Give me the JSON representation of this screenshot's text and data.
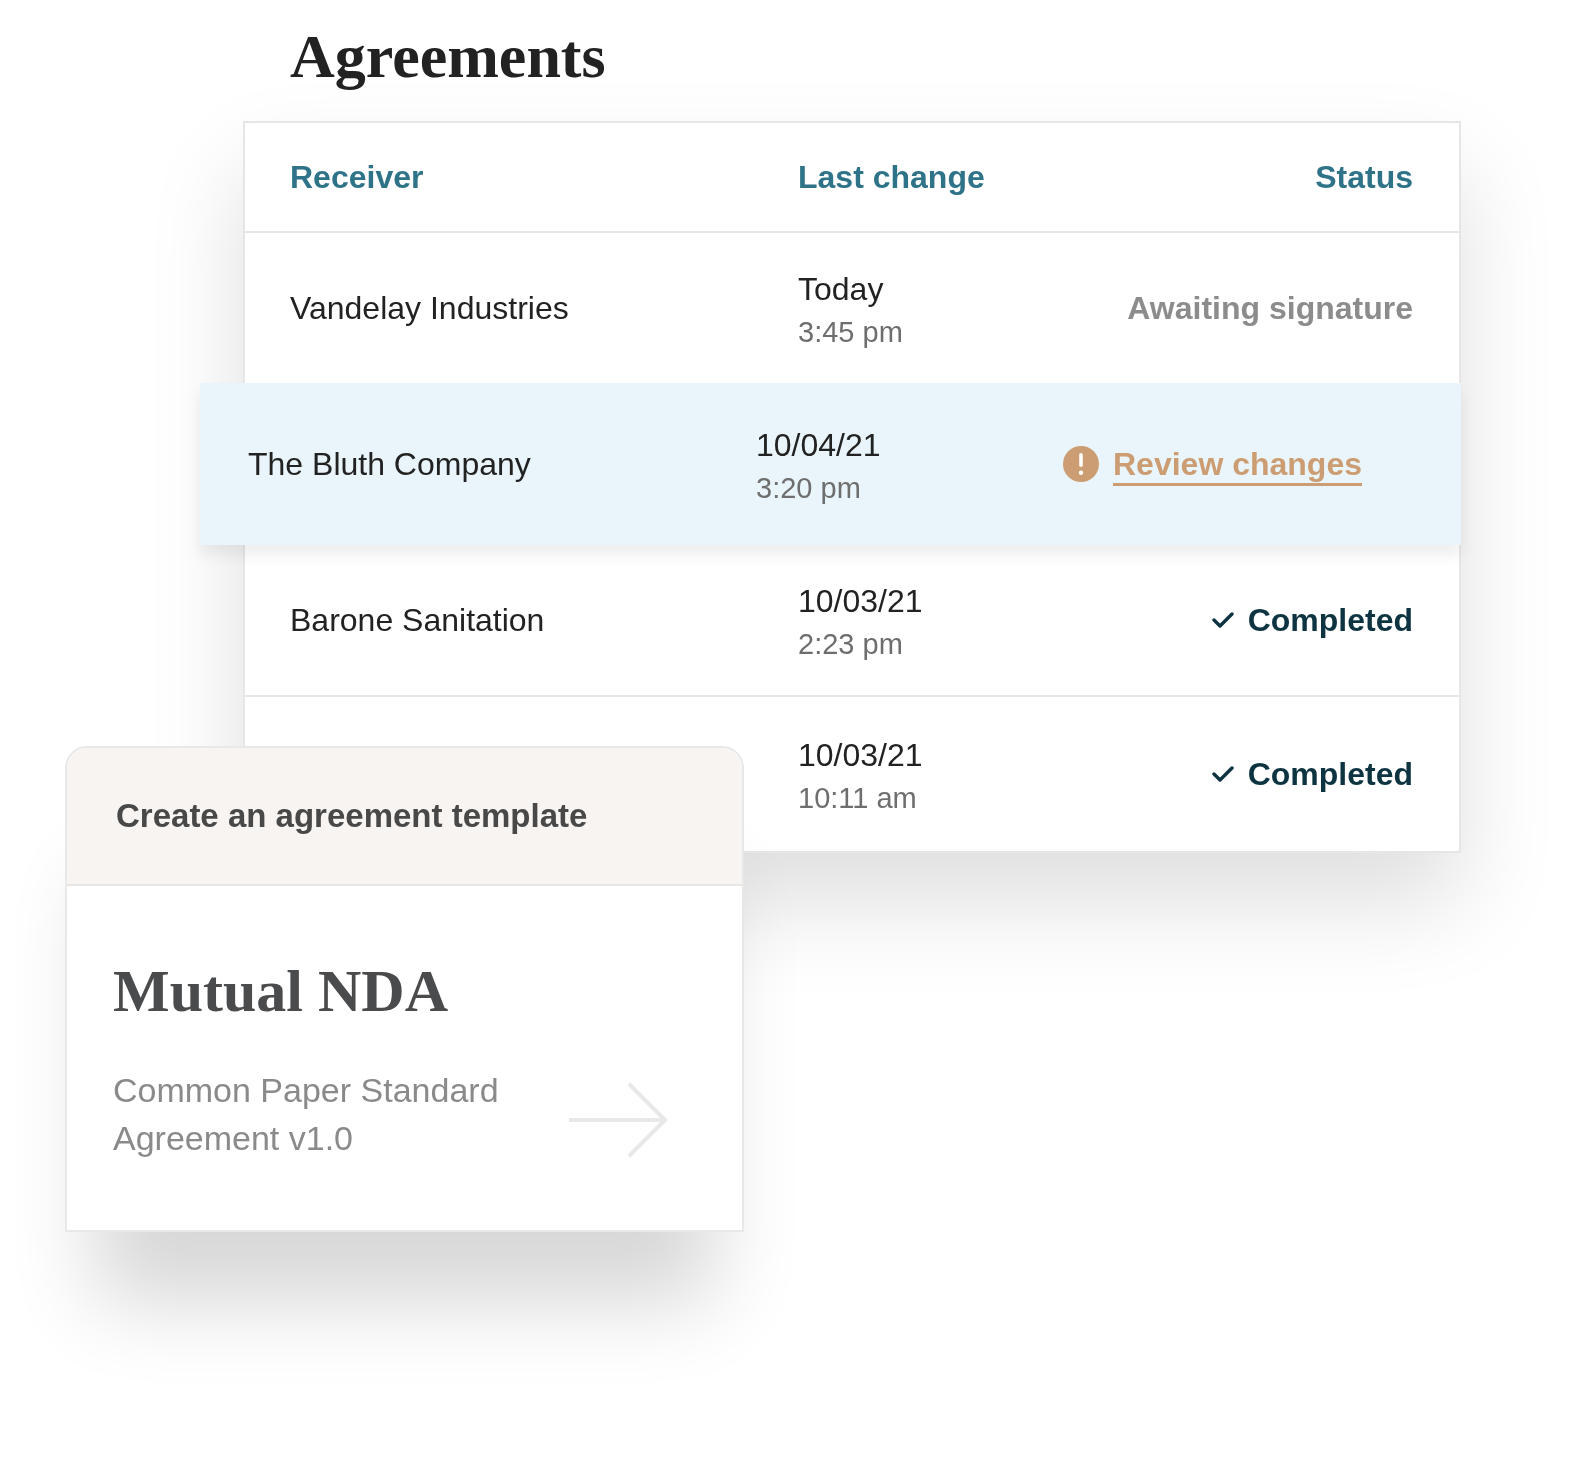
{
  "title": "Agreements",
  "table": {
    "columns": [
      "Receiver",
      "Last change",
      "Status"
    ],
    "rows": [
      {
        "receiver": "Vandelay Industries",
        "date": "Today",
        "time": "3:45 pm",
        "status": {
          "kind": "awaiting",
          "label": "Awaiting signature"
        },
        "selected": false
      },
      {
        "receiver": "The Bluth Company",
        "date": "10/04/21",
        "time": "3:20 pm",
        "status": {
          "kind": "review",
          "label": "Review changes"
        },
        "selected": true
      },
      {
        "receiver": "Barone Sanitation",
        "date": "10/03/21",
        "time": "2:23 pm",
        "status": {
          "kind": "completed",
          "label": "Completed"
        },
        "selected": false
      },
      {
        "date": "10/03/21",
        "time": "10:11 am",
        "status": {
          "kind": "completed",
          "label": "Completed"
        },
        "selected": false
      }
    ]
  },
  "template_card": {
    "header": "Create an agreement template",
    "title": "Mutual NDA",
    "subtitle": "Common Paper Standard Agreement v1.0"
  }
}
